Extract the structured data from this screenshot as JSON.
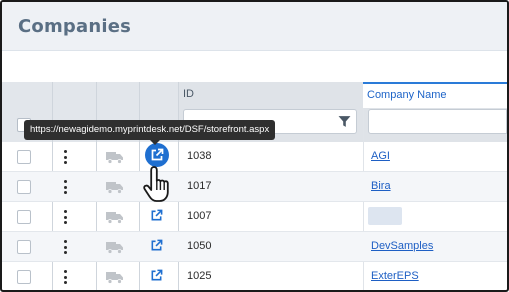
{
  "page": {
    "title": "Companies"
  },
  "grid": {
    "columns": {
      "id": "ID",
      "company_name": "Company Name"
    },
    "filters": {
      "id_value": "",
      "company_value": ""
    },
    "rows": [
      {
        "id": "1038",
        "company": "AGI"
      },
      {
        "id": "1017",
        "company": "Bira"
      },
      {
        "id": "1007",
        "company": ""
      },
      {
        "id": "1050",
        "company": "DevSamples"
      },
      {
        "id": "1025",
        "company": "ExterEPS"
      }
    ]
  },
  "tooltip": {
    "text": "https://newagidemo.myprintdesk.net/DSF/storefront.aspx"
  },
  "icons": {
    "row_menu": "kebab-menu-icon",
    "shipping": "truck-icon",
    "open_storefront": "external-link-icon",
    "filter": "filter-icon",
    "cursor": "hand-pointer-icon"
  },
  "colors": {
    "accent": "#1f6fd0",
    "link": "#1e5fc4",
    "header_bg": "#eef1f5",
    "tooltip_bg": "#2f2f2f",
    "title": "#5a6f84"
  }
}
